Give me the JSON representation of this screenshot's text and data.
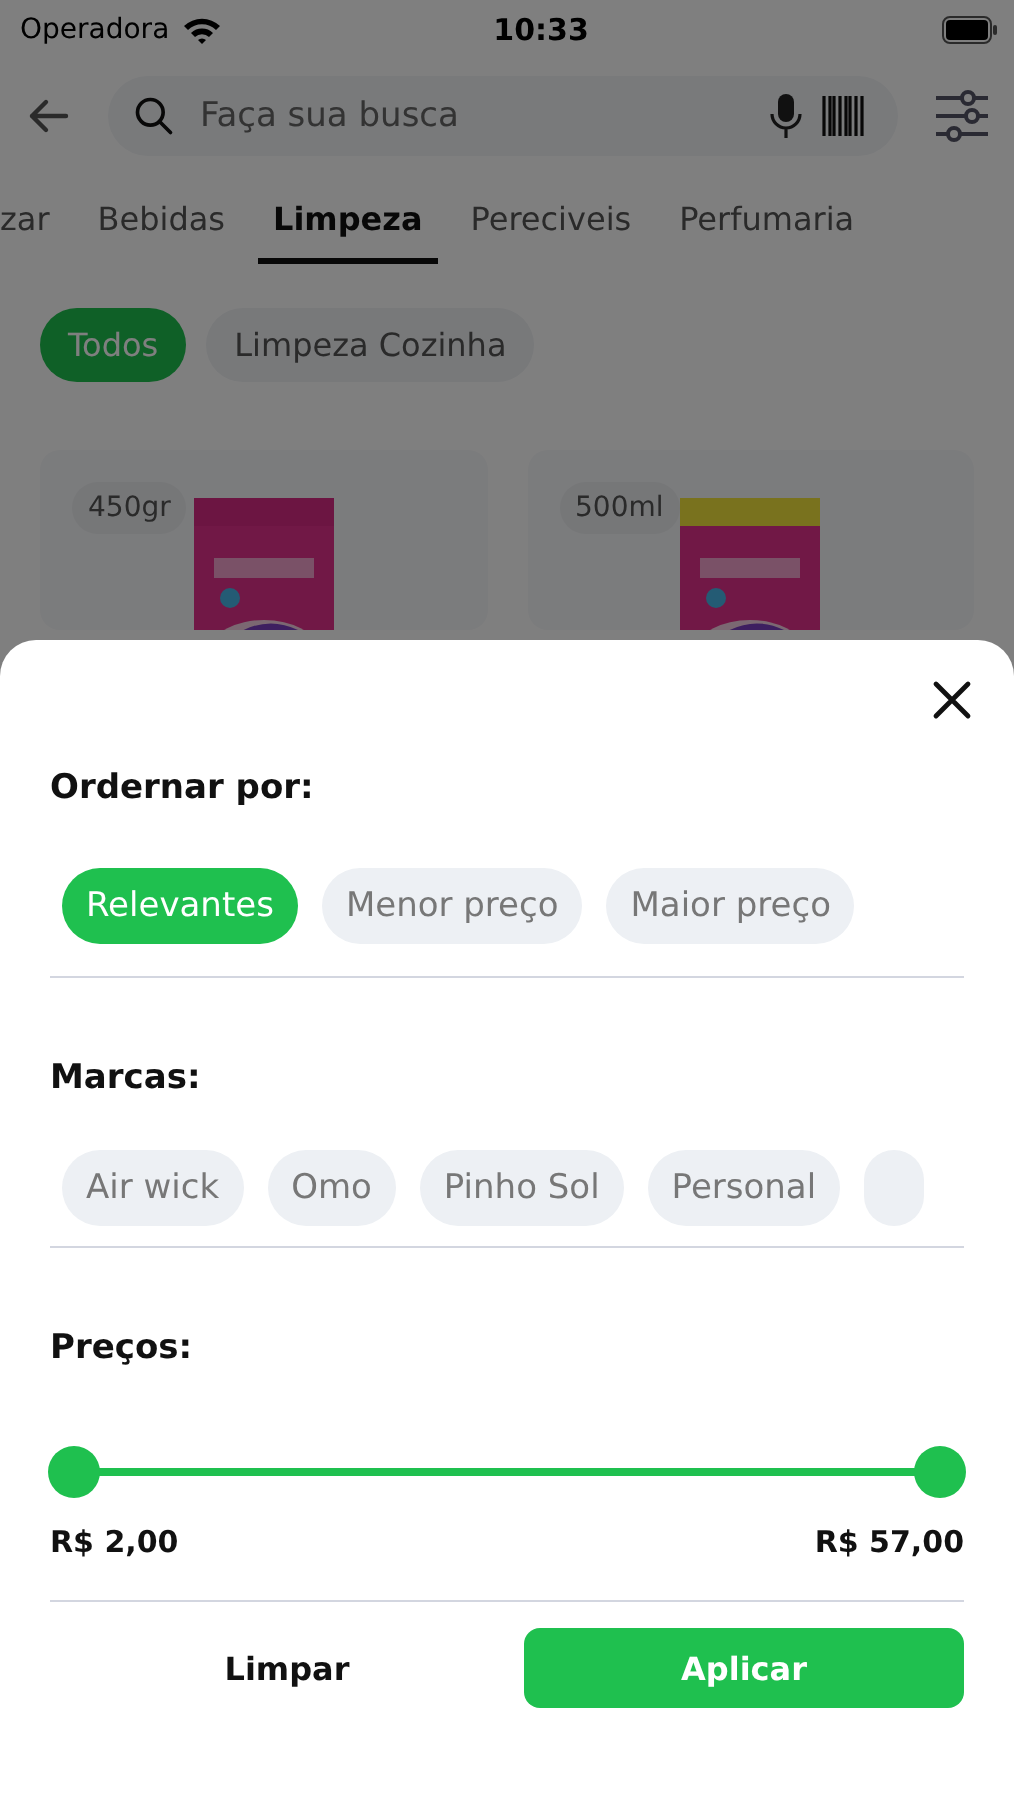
{
  "status_bar": {
    "carrier": "Operadora",
    "time": "10:33"
  },
  "search": {
    "placeholder": "Faça sua busca"
  },
  "tabs": [
    {
      "label": "zar",
      "selected": false
    },
    {
      "label": "Bebidas",
      "selected": false
    },
    {
      "label": "Limpeza",
      "selected": true
    },
    {
      "label": "Pereciveis",
      "selected": false
    },
    {
      "label": "Perfumaria",
      "selected": false
    }
  ],
  "subcategories": [
    {
      "label": "Todos",
      "selected": true
    },
    {
      "label": "Limpeza Cozinha",
      "selected": false
    }
  ],
  "products": [
    {
      "size": "450gr",
      "kind": "picture"
    },
    {
      "size": "500ml",
      "kind": "picture"
    }
  ],
  "filter_sheet": {
    "sort_title": "Ordernar por:",
    "sort_options": [
      {
        "label": "Relevantes",
        "selected": true
      },
      {
        "label": "Menor preço",
        "selected": false
      },
      {
        "label": "Maior preço",
        "selected": false
      }
    ],
    "brands_title": "Marcas:",
    "brands": [
      {
        "label": "Air wick",
        "selected": false
      },
      {
        "label": "Omo",
        "selected": false
      },
      {
        "label": "Pinho Sol",
        "selected": false
      },
      {
        "label": "Personal",
        "selected": false
      }
    ],
    "price_title": "Preços:",
    "price_thumbs": [
      {
        "level": 0
      },
      {
        "level": 1
      }
    ],
    "price_min": "R$ 2,00",
    "price_max": "R$ 57,00",
    "clear_button": "Limpar",
    "apply_button": "Aplicar"
  }
}
